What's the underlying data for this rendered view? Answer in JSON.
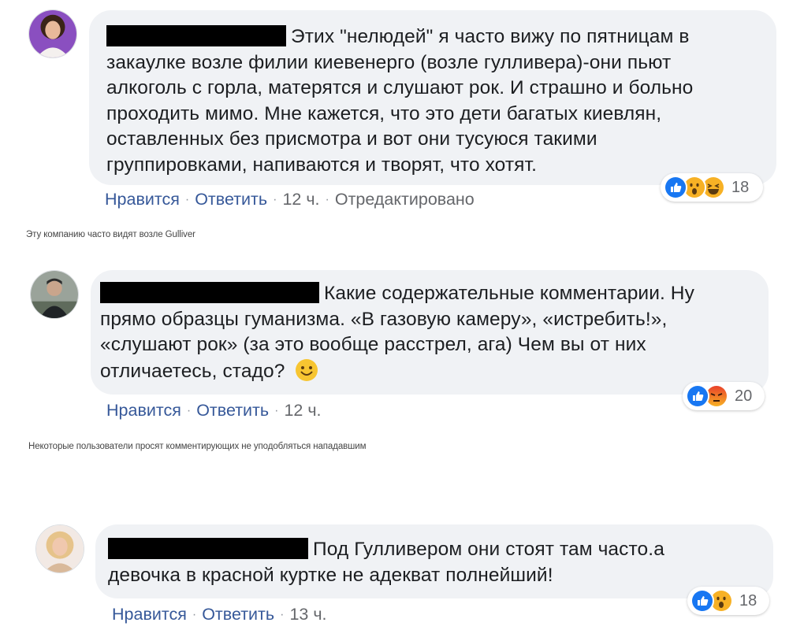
{
  "comments": [
    {
      "text": "Этих \"нелюдей\" я часто вижу по пятницам в закаулке возле филии киевенерго (возле гулливера)-они пьют алкоголь с горла, матерятся и слушают рок. И страшно и больно проходить мимо. Мне кажется, что это дети багатых киевлян, оставленных без присмотра и вот они тусуюся такими группировками, напиваются и творят, что хотят.",
      "line1": "Этих \"нелюдей\" я часто вижу по пятницам в",
      "line2": "закаулке возле филии киевенерго (возле гулливера)-они пьют",
      "line3": "алкоголь с горла, матерятся и слушают рок. И страшно и больно",
      "line4": "проходить мимо. Мне кажется, что это дети багатых киевлян,",
      "line5": "оставленных без присмотра и вот они тусуюся такими",
      "line6": "группировками, напиваются и творят, что хотят.",
      "like": "Нравится",
      "reply": "Ответить",
      "time": "12 ч.",
      "edited": "Отредактировано",
      "reaction_icons": [
        "like-icon",
        "wow-icon",
        "haha-icon"
      ],
      "reaction_count": "18"
    },
    {
      "line1": "Какие содержательные комментарии. Ну",
      "line2": "прямо образцы гуманизма. «В газовую камеру», «истребить!»,",
      "line3": "«слушают рок» (за это вообще расстрел, ага) Чем вы от них",
      "line4": "отличаетесь, стадо?",
      "like": "Нравится",
      "reply": "Ответить",
      "time": "12 ч.",
      "reaction_icons": [
        "like-icon",
        "angry-icon"
      ],
      "reaction_count": "20"
    },
    {
      "line1": "Под Гулливером они стоят там часто.а",
      "line2": "девочка в красной куртке не адекват полнейший!",
      "like": "Нравится",
      "reply": "Ответить",
      "time": "13 ч.",
      "reaction_icons": [
        "like-icon",
        "wow-icon"
      ],
      "reaction_count": "18"
    }
  ],
  "captions": {
    "first": "Эту компанию часто видят возле Gulliver",
    "second": "Некоторые пользователи просят комментирующих не уподобляться нападавшим"
  },
  "colors": {
    "bubble": "#f0f2f5",
    "link": "#365899",
    "like_blue": "#1877f2",
    "emoji_yellow": "#f7b125",
    "angry_red": "#e9710f",
    "redaction": "#000000"
  }
}
